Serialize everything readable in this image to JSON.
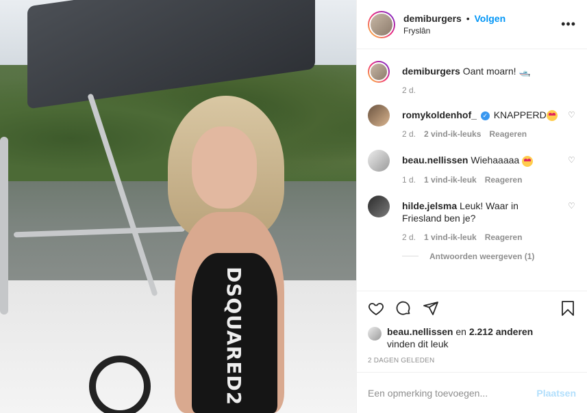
{
  "post": {
    "author": "demiburgers",
    "follow_label": "Volgen",
    "separator": "•",
    "location": "Fryslân",
    "more_icon": "more-options-icon"
  },
  "caption": {
    "username": "demiburgers",
    "text": "Oant moarn! 🛥️",
    "time": "2 d."
  },
  "comments": [
    {
      "username": "romykoldenhof_",
      "verified": true,
      "text": "KNAPPERD",
      "emoji": "heart-eyes",
      "time": "2 d.",
      "likes": "2 vind-ik-leuks",
      "reply": "Reageren"
    },
    {
      "username": "beau.nellissen",
      "verified": false,
      "text": "Wiehaaaaa",
      "emoji": "heart-eyes",
      "time": "1 d.",
      "likes": "1 vind-ik-leuk",
      "reply": "Reageren"
    },
    {
      "username": "hilde.jelsma",
      "verified": false,
      "text": "Leuk! Waar in Friesland ben je?",
      "emoji": "",
      "time": "2 d.",
      "likes": "1 vind-ik-leuk",
      "reply": "Reageren"
    }
  ],
  "view_replies": "Antwoorden weergeven (1)",
  "liked_by": {
    "user": "beau.nellissen",
    "connector": "en",
    "others": "2.212 anderen",
    "suffix": "vinden dit leuk"
  },
  "post_age": "2 DAGEN GELEDEN",
  "add_comment": {
    "placeholder": "Een opmerking toevoegen...",
    "post_label": "Plaatsen"
  },
  "photo": {
    "suit_text": "DSQUARED2"
  },
  "colors": {
    "link_blue": "#0095f6",
    "post_disabled": "#b2dffc",
    "secondary_text": "#8e8e8e"
  }
}
